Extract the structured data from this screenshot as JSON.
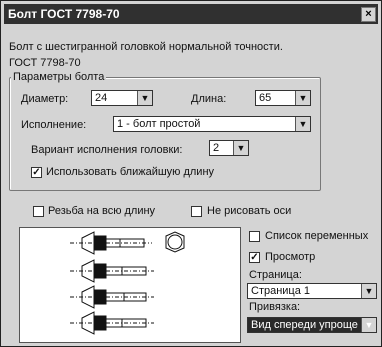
{
  "window": {
    "title": "Болт ГОСТ 7798-70",
    "close_glyph": "×"
  },
  "description": "Болт с шестигранной головкой нормальной точности.",
  "standard": "ГОСТ 7798-70",
  "params": {
    "title": "Параметры болта",
    "diameter_label": "Диаметр:",
    "diameter_value": "24",
    "length_label": "Длина:",
    "length_value": "65",
    "execution_label": "Исполнение:",
    "execution_value": "1 - болт простой",
    "head_variant_label": "Вариант исполнения головки:",
    "head_variant_value": "2",
    "use_nearest_label": "Использовать ближайшую длину",
    "use_nearest_checked": true
  },
  "options": {
    "full_thread_label": "Резьба на всю длину",
    "full_thread_checked": false,
    "no_axes_label": "Не рисовать оси",
    "no_axes_checked": false,
    "var_list_label": "Список переменных",
    "var_list_checked": false,
    "preview_label": "Просмотр",
    "preview_checked": true
  },
  "page": {
    "label": "Страница:",
    "value": "Страница 1"
  },
  "binding": {
    "label": "Привязка:",
    "value": "Вид спереди упроще"
  },
  "icons": {
    "dropdown": "dropdown-arrow-icon",
    "check": "checkmark-icon"
  }
}
